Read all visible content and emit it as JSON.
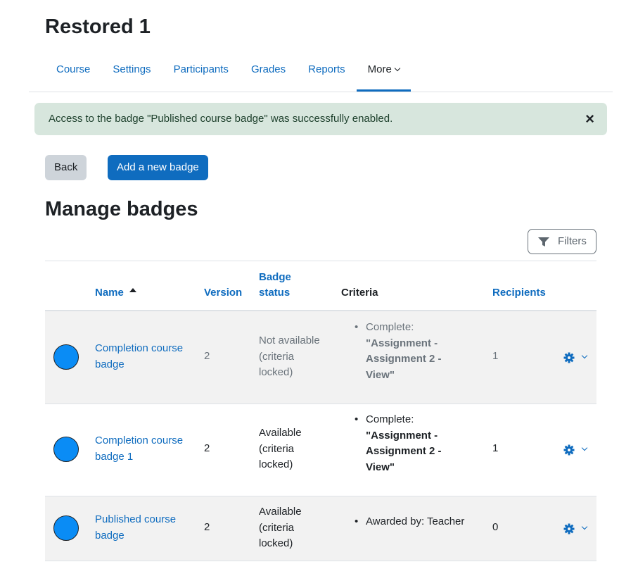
{
  "page": {
    "title": "Restored 1"
  },
  "nav": {
    "items": [
      {
        "label": "Course"
      },
      {
        "label": "Settings"
      },
      {
        "label": "Participants"
      },
      {
        "label": "Grades"
      },
      {
        "label": "Reports"
      },
      {
        "label": "More"
      }
    ],
    "active": "More"
  },
  "alert": {
    "message": "Access to the badge \"Published course badge\" was successfully enabled.",
    "close": "×"
  },
  "buttons": {
    "back": "Back",
    "add_badge": "Add a new badge"
  },
  "section": {
    "title": "Manage badges"
  },
  "filters": {
    "label": "Filters",
    "icon": "funnel-icon"
  },
  "table": {
    "headers": {
      "name": "Name",
      "version": "Version",
      "badge_status_1": "Badge",
      "badge_status_2": "status",
      "criteria": "Criteria",
      "recipients": "Recipients"
    },
    "sort": {
      "column": "Name",
      "direction": "ascending"
    },
    "rows": [
      {
        "name_1": "Completion course",
        "name_2": "badge",
        "version": "2",
        "status_1": "Not available",
        "status_2": "(criteria",
        "status_3": "locked)",
        "criteria_prefix": "Complete:",
        "criteria_1": "\"Assignment -",
        "criteria_2": "Assignment 2 -",
        "criteria_3": "View\"",
        "recipients": "1"
      },
      {
        "name_1": "Completion course",
        "name_2": "badge 1",
        "version": "2",
        "status_1": "Available",
        "status_2": "(criteria",
        "status_3": "locked)",
        "criteria_prefix": "Complete:",
        "criteria_1": "\"Assignment -",
        "criteria_2": "Assignment 2 -",
        "criteria_3": "View\"",
        "recipients": "1"
      },
      {
        "name_1": "Published course",
        "name_2": "badge",
        "version": "2",
        "status_1": "Available",
        "status_2": "(criteria",
        "status_3": "locked)",
        "criteria_text": "Awarded by: Teacher",
        "recipients": "0"
      }
    ]
  },
  "colors": {
    "link": "#0f6cbf",
    "badge": "#0a8cf5",
    "alert_bg": "#d7e6dd",
    "row_grey": "#f2f2f2"
  }
}
